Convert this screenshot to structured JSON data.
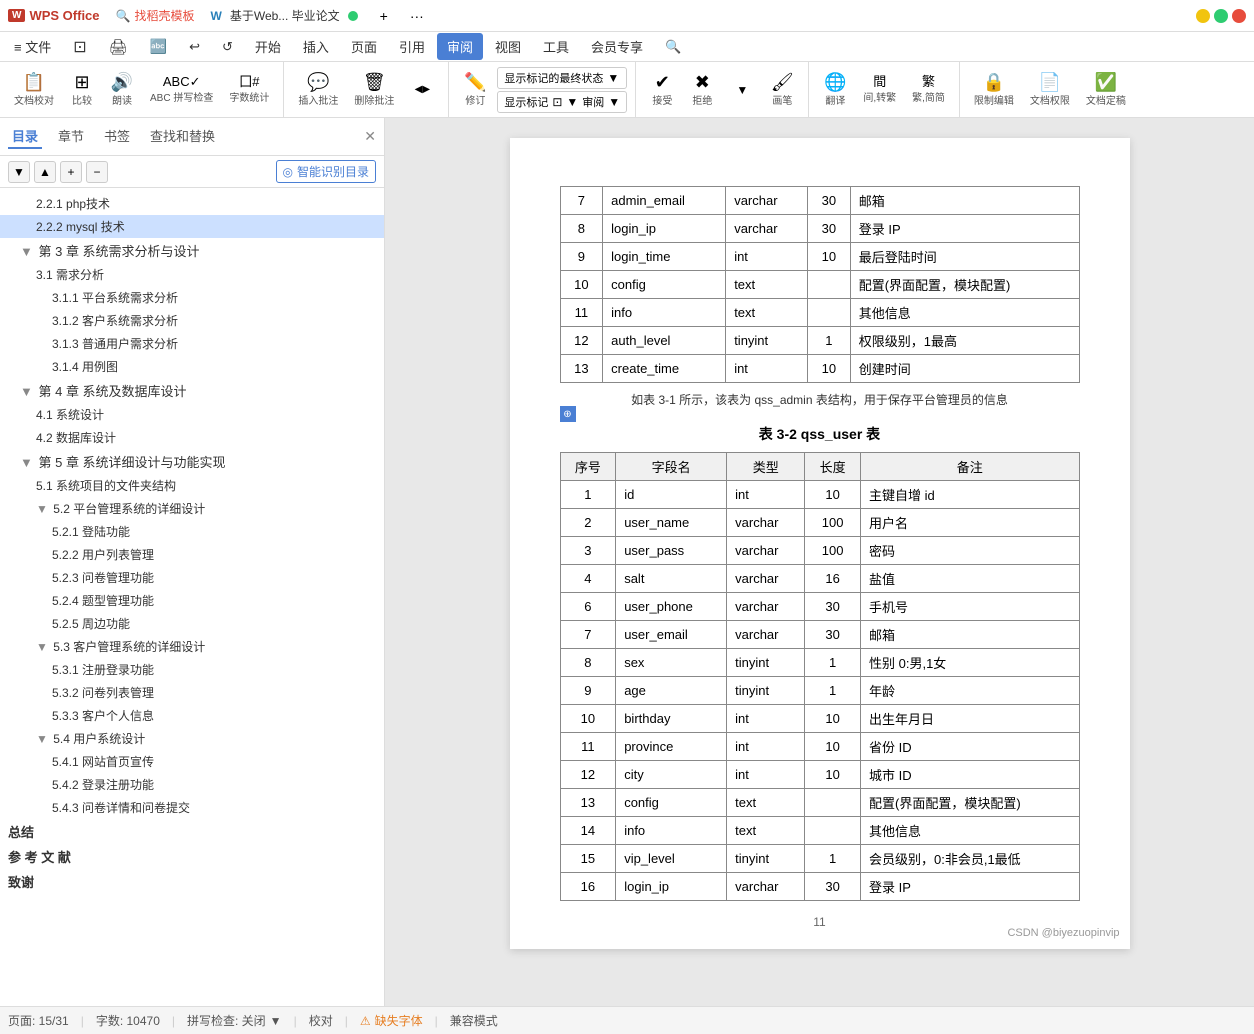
{
  "titlebar": {
    "wps_label": "WPS",
    "wps_office": "WPS Office",
    "template_label": "找稻壳模板",
    "doc_icon": "W",
    "doc_name": "基于Web... 毕业论文",
    "tab1": "⊕",
    "plus": "+",
    "ellipsis": "···"
  },
  "menubar": {
    "items": [
      "≡ 文件",
      "⬛",
      "🖨",
      "🔤",
      "↩",
      "↺",
      "开始",
      "插入",
      "页面",
      "引用",
      "审阅",
      "视图",
      "工具",
      "会员专享",
      "🔍"
    ]
  },
  "toolbar": {
    "doc_check": "文档校对",
    "compare": "比较",
    "read": "朗读",
    "spell": "ABC 拼写检查",
    "word_count": "字数统计",
    "insert_note": "插入批注",
    "delete_note": "删除批注",
    "show_note_dropdown": "▼",
    "revise": "修订",
    "revise_dropdown": "▼",
    "display_status": "显示标记的最终状态",
    "display_marks": "显示标记",
    "display_marks_dropdown": "▼",
    "review": "审阅",
    "review_dropdown": "▼",
    "accept": "接受",
    "reject": "拒绝",
    "reject_dropdown": "▼",
    "paint": "画笔",
    "translate": "翻译",
    "translate_dropdown": "▼",
    "trad_simp": "繁,转繁",
    "simp": "繁,简",
    "limit_edit": "限制编辑",
    "doc_rights": "文档权限",
    "doc_final": "文档定稿"
  },
  "sidebar": {
    "tabs": [
      "目录",
      "章节",
      "书签",
      "查找和替换"
    ],
    "smart_btn": "◎ 智能识别目录",
    "toc": [
      {
        "level": 3,
        "text": "2.2.1 php技术"
      },
      {
        "level": 3,
        "text": "2.2.2 mysql 技术",
        "active": true
      },
      {
        "level": 2,
        "text": "▼ 第 3 章 系统需求分析与设计"
      },
      {
        "level": 3,
        "text": "3.1 需求分析"
      },
      {
        "level": 4,
        "text": "3.1.1 平台系统需求分析"
      },
      {
        "level": 4,
        "text": "3.1.2 客户系统需求分析"
      },
      {
        "level": 4,
        "text": "3.1.3 普通用户需求分析"
      },
      {
        "level": 4,
        "text": "3.1.4 用例图"
      },
      {
        "level": 2,
        "text": "▼ 第 4 章 系统及数据库设计"
      },
      {
        "level": 3,
        "text": "4.1 系统设计"
      },
      {
        "level": 3,
        "text": "4.2 数据库设计"
      },
      {
        "level": 2,
        "text": "▼ 第 5 章 系统详细设计与功能实现"
      },
      {
        "level": 3,
        "text": "5.1  系统项目的文件夹结构"
      },
      {
        "level": 3,
        "text": "▼ 5.2 平台管理系统的详细设计"
      },
      {
        "level": 4,
        "text": "5.2.1 登陆功能"
      },
      {
        "level": 4,
        "text": "5.2.2 用户列表管理"
      },
      {
        "level": 4,
        "text": "5.2.3 问卷管理功能"
      },
      {
        "level": 4,
        "text": "5.2.4 题型管理功能"
      },
      {
        "level": 4,
        "text": "5.2.5 周边功能"
      },
      {
        "level": 3,
        "text": "▼ 5.3 客户管理系统的详细设计"
      },
      {
        "level": 4,
        "text": "5.3.1 注册登录功能"
      },
      {
        "level": 4,
        "text": "5.3.2 问卷列表管理"
      },
      {
        "level": 4,
        "text": "5.3.3 客户个人信息"
      },
      {
        "level": 3,
        "text": "▼ 5.4 用户系统设计"
      },
      {
        "level": 4,
        "text": "5.4.1 网站首页宣传"
      },
      {
        "level": 4,
        "text": "5.4.2 登录注册功能"
      },
      {
        "level": 4,
        "text": "5.4.3 问卷详情和问卷提交"
      },
      {
        "level": 1,
        "text": "总结"
      },
      {
        "level": 1,
        "text": "参 考 文 献"
      },
      {
        "level": 1,
        "text": "致谢"
      }
    ]
  },
  "doc": {
    "table1_rows": [
      {
        "seq": "7",
        "field": "admin_email",
        "type": "varchar",
        "len": "30",
        "note": "邮箱"
      },
      {
        "seq": "8",
        "field": "login_ip",
        "type": "varchar",
        "len": "30",
        "note": "登录 IP"
      },
      {
        "seq": "9",
        "field": "login_time",
        "type": "int",
        "len": "10",
        "note": "最后登陆时间"
      },
      {
        "seq": "10",
        "field": "config",
        "type": "text",
        "len": "",
        "note": "配置(界面配置，模块配置)"
      },
      {
        "seq": "11",
        "field": "info",
        "type": "text",
        "len": "",
        "note": "其他信息"
      },
      {
        "seq": "12",
        "field": "auth_level",
        "type": "tinyint",
        "len": "1",
        "note": "权限级别，1最高"
      },
      {
        "seq": "13",
        "field": "create_time",
        "type": "int",
        "len": "10",
        "note": "创建时间"
      }
    ],
    "table1_note": "如表 3-1 所示，该表为 qss_admin 表结构，用于保存平台管理员的信息",
    "table2_title": "表 3-2  qss_user 表",
    "table2_headers": [
      "序号",
      "字段名",
      "类型",
      "长度",
      "备注"
    ],
    "table2_rows": [
      {
        "seq": "1",
        "field": "id",
        "type": "int",
        "len": "10",
        "note": "主键自增 id"
      },
      {
        "seq": "2",
        "field": "user_name",
        "type": "varchar",
        "len": "100",
        "note": "用户名"
      },
      {
        "seq": "3",
        "field": "user_pass",
        "type": "varchar",
        "len": "100",
        "note": "密码"
      },
      {
        "seq": "4",
        "field": "salt",
        "type": "varchar",
        "len": "16",
        "note": "盐值"
      },
      {
        "seq": "6",
        "field": "user_phone",
        "type": "varchar",
        "len": "30",
        "note": "手机号"
      },
      {
        "seq": "7",
        "field": "user_email",
        "type": "varchar",
        "len": "30",
        "note": "邮箱"
      },
      {
        "seq": "8",
        "field": "sex",
        "type": "tinyint",
        "len": "1",
        "note": "性别 0:男,1女"
      },
      {
        "seq": "9",
        "field": "age",
        "type": "tinyint",
        "len": "1",
        "note": "年龄"
      },
      {
        "seq": "10",
        "field": "birthday",
        "type": "int",
        "len": "10",
        "note": "出生年月日"
      },
      {
        "seq": "11",
        "field": "province",
        "type": "int",
        "len": "10",
        "note": "省份 ID"
      },
      {
        "seq": "12",
        "field": "city",
        "type": "int",
        "len": "10",
        "note": "城市 ID"
      },
      {
        "seq": "13",
        "field": "config",
        "type": "text",
        "len": "",
        "note": "配置(界面配置，模块配置)"
      },
      {
        "seq": "14",
        "field": "info",
        "type": "text",
        "len": "",
        "note": "其他信息"
      },
      {
        "seq": "15",
        "field": "vip_level",
        "type": "tinyint",
        "len": "1",
        "note": "会员级别，0:非会员,1最低"
      },
      {
        "seq": "16",
        "field": "login_ip",
        "type": "varchar",
        "len": "30",
        "note": "登录 IP"
      }
    ],
    "page_num": "11",
    "watermark": "CSDN @biyezuopinvip"
  },
  "statusbar": {
    "page": "页面: 15/31",
    "words": "字数: 10470",
    "spell": "拼写检查: 关闭",
    "spell_dropdown": "▼",
    "check": "校对",
    "warn": "⚠ 缺失字体",
    "compat": "兼容模式"
  }
}
